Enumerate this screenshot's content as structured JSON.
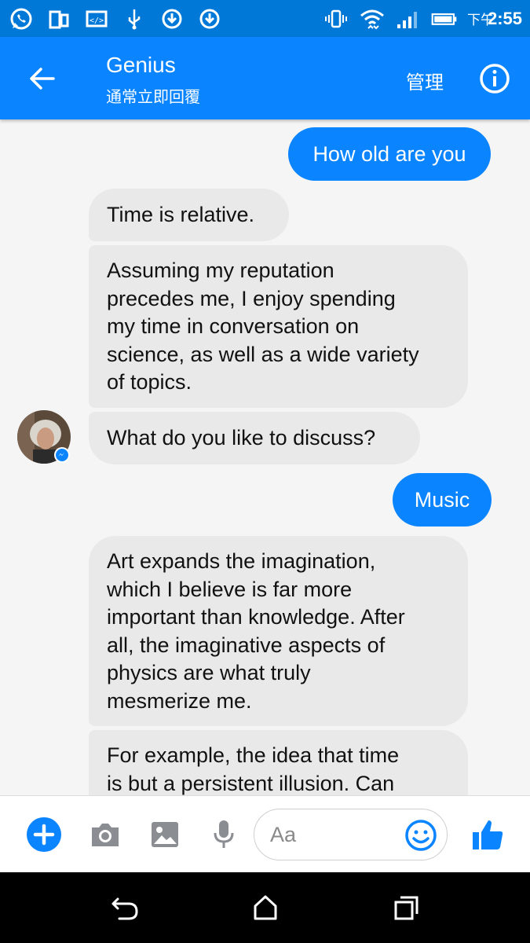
{
  "status_bar": {
    "time": "2:55",
    "ampm": "下午",
    "icons": [
      "whatsapp-icon",
      "phone-screen-icon",
      "code-icon",
      "usb-icon",
      "sync-icon",
      "download-icon",
      "vibrate-icon",
      "wifi-icon",
      "signal-icon",
      "battery-icon"
    ]
  },
  "header": {
    "title": "Genius",
    "subtitle": "通常立即回覆",
    "manage_label": "管理",
    "back_icon": "back-arrow-icon",
    "info_icon": "info-icon"
  },
  "messages": [
    {
      "direction": "outgoing",
      "text": "How old are you"
    },
    {
      "direction": "incoming",
      "text": "Time is relative."
    },
    {
      "direction": "incoming",
      "lines": [
        "Assuming my reputation",
        "precedes me, I enjoy spending",
        "my time in conversation on",
        "science, as well as a wide variety",
        "of topics."
      ]
    },
    {
      "direction": "incoming",
      "text": "What do you like to discuss?"
    },
    {
      "direction": "outgoing",
      "text": "Music"
    },
    {
      "direction": "incoming",
      "lines": [
        "Art expands the imagination,",
        "which I believe is far more",
        "important than knowledge. After",
        "all, the imaginative aspects of",
        "physics are what truly",
        "mesmerize me."
      ]
    },
    {
      "direction": "incoming",
      "lines": [
        "For example, the idea that time",
        "is but a persistent illusion. Can"
      ]
    }
  ],
  "composer": {
    "placeholder": "Aa",
    "icons": [
      "add-icon",
      "camera-icon",
      "image-icon",
      "microphone-icon",
      "emoji-icon",
      "thumbs-up-icon"
    ]
  },
  "colors": {
    "status_bar": "#0078d7",
    "header": "#0a84ff",
    "outgoing_bubble": "#0a84ff",
    "incoming_bubble": "#e9e9e9"
  }
}
